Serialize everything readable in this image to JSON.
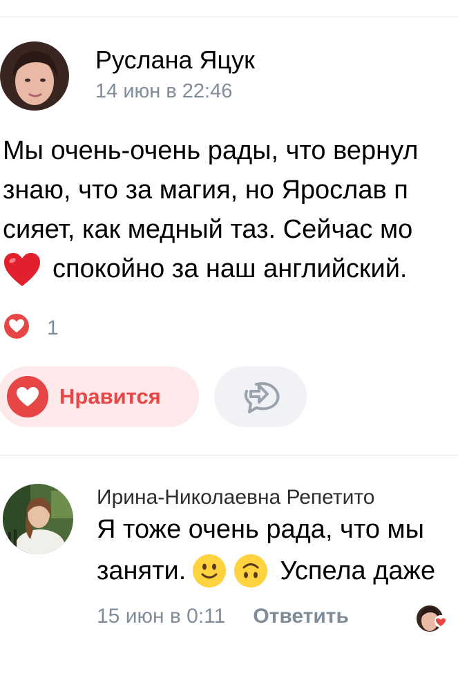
{
  "post": {
    "author_name": "Руслана Яцук",
    "date": "14 июн в 22:46",
    "text_lines": [
      "Мы очень-очень рады, что вернул",
      "знаю, что за магия, но Ярослав п",
      "сияет, как медный таз. Сейчас мо",
      "спокойно за наш английский."
    ],
    "last_line_emoji": "red-heart-emoji",
    "likes_count": "1",
    "like_button_label": "Нравится",
    "share_icon": "share-icon"
  },
  "comment": {
    "author_name": "Ирина-Николаевна Репетито",
    "text_line_1": "Я тоже очень рада, что мы",
    "text_line_2": "заняти.",
    "text_line_2_tail": "Успела даже",
    "emojis": [
      "slightly-smiling-emoji",
      "upside-down-emoji"
    ],
    "date": "15 июн в 0:11",
    "reply_label": "Ответить"
  },
  "colors": {
    "like_red": "#e64646",
    "like_bg": "#fde8ea",
    "secondary_text": "#818c99",
    "share_bg": "#f0f2f5"
  }
}
